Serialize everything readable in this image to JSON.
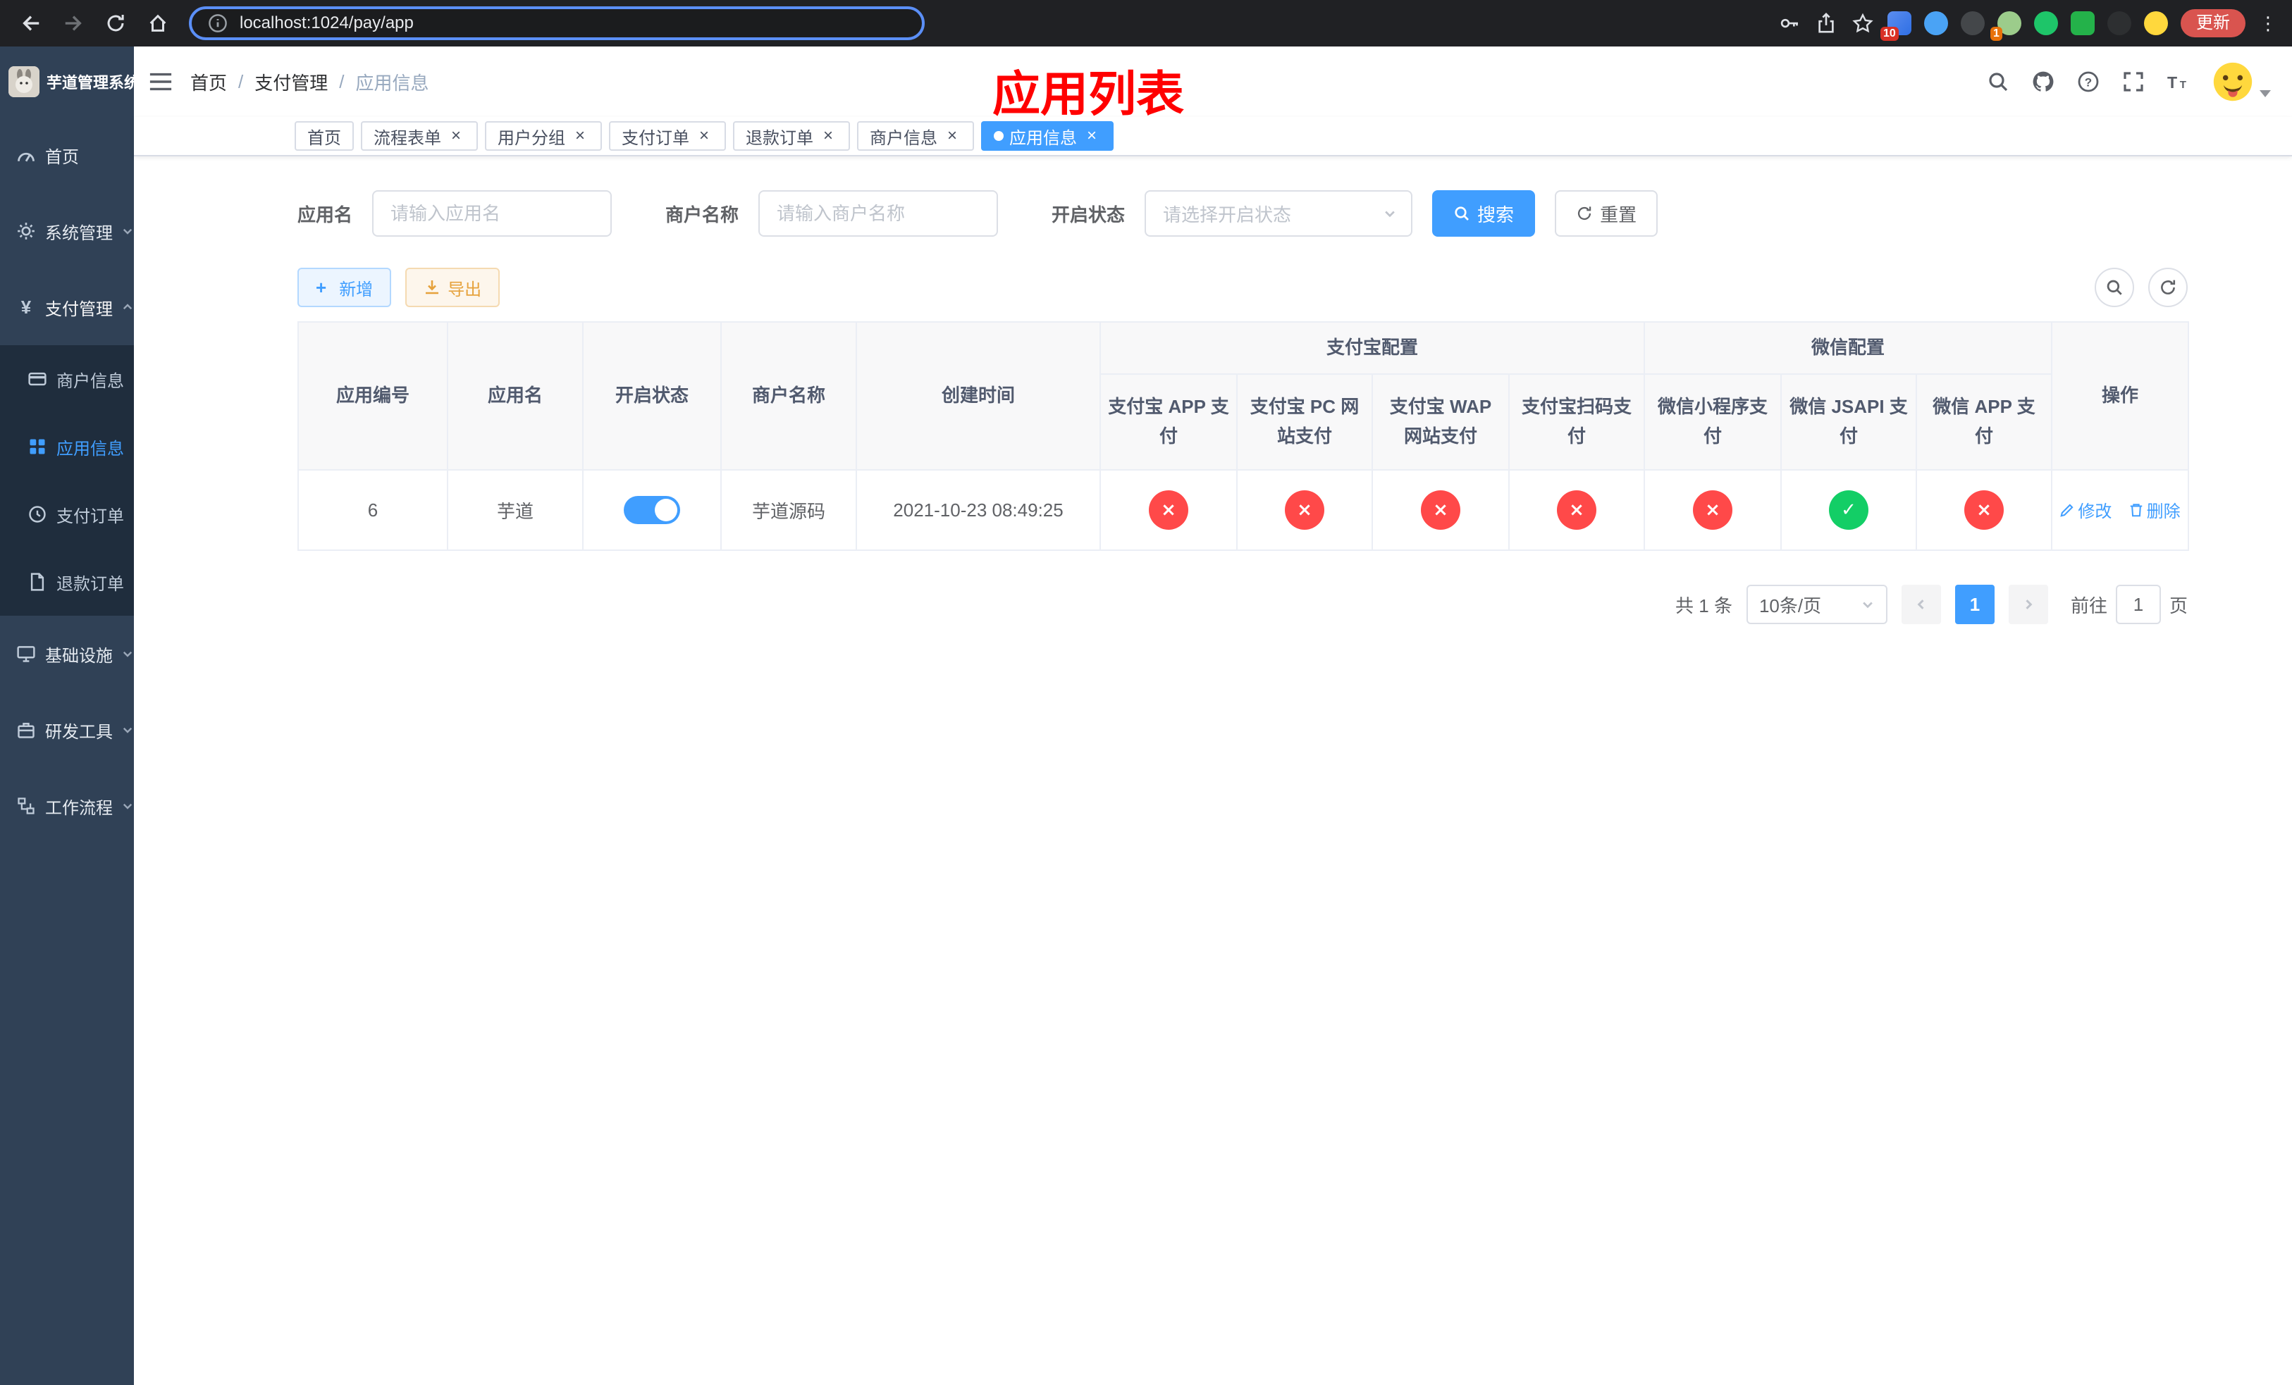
{
  "colors": {
    "accent": "#409eff",
    "sidebar_bg": "#304156",
    "submenu_bg": "#1f2d3d",
    "danger_circle": "#ff4949",
    "success_circle": "#13ce66",
    "warning": "#e6a23c",
    "annotation": "#ff0000",
    "active_tab_bg": "#409eff"
  },
  "browser": {
    "url": "localhost:1024/pay/app",
    "update_label": "更新",
    "ext_badge_a": "10",
    "ext_badge_b": "1"
  },
  "sidebar": {
    "title": "芋道管理系统",
    "items": [
      {
        "label": "首页"
      },
      {
        "label": "系统管理"
      },
      {
        "label": "支付管理"
      },
      {
        "label": "商户信息"
      },
      {
        "label": "应用信息"
      },
      {
        "label": "支付订单"
      },
      {
        "label": "退款订单"
      },
      {
        "label": "基础设施"
      },
      {
        "label": "研发工具"
      },
      {
        "label": "工作流程"
      }
    ]
  },
  "header": {
    "breadcrumb": {
      "home": "首页",
      "section": "支付管理",
      "current": "应用信息",
      "separator": "/"
    },
    "annotation": "应用列表"
  },
  "tabs": [
    {
      "label": "首页"
    },
    {
      "label": "流程表单"
    },
    {
      "label": "用户分组"
    },
    {
      "label": "支付订单"
    },
    {
      "label": "退款订单"
    },
    {
      "label": "商户信息"
    },
    {
      "label": "应用信息"
    }
  ],
  "filters": {
    "app_name": {
      "label": "应用名",
      "placeholder": "请输入应用名"
    },
    "merchant_name": {
      "label": "商户名称",
      "placeholder": "请输入商户名称"
    },
    "status": {
      "label": "开启状态",
      "placeholder": "请选择开启状态"
    },
    "search_label": "搜索",
    "reset_label": "重置"
  },
  "toolbar": {
    "add_label": "新增",
    "export_label": "导出"
  },
  "table": {
    "group_alipay": "支付宝配置",
    "group_wechat": "微信配置",
    "columns": {
      "id": "应用编号",
      "name": "应用名",
      "status": "开启状态",
      "merchant": "商户名称",
      "created": "创建时间",
      "alipay_app": "支付宝 APP 支付",
      "alipay_pc": "支付宝 PC 网站支付",
      "alipay_wap": "支付宝 WAP 网站支付",
      "alipay_qr": "支付宝扫码支付",
      "wx_lite": "微信小程序支付",
      "wx_jsapi": "微信 JSAPI 支付",
      "wx_app": "微信 APP 支付",
      "actions": "操作"
    },
    "rows": [
      {
        "id": "6",
        "name": "芋道",
        "enabled": true,
        "merchant": "芋道源码",
        "created": "2021-10-23 08:49:25",
        "channels": {
          "alipay_app": false,
          "alipay_pc": false,
          "alipay_wap": false,
          "alipay_qr": false,
          "wx_lite": false,
          "wx_jsapi": true,
          "wx_app": false
        },
        "edit_label": "修改",
        "delete_label": "删除"
      }
    ]
  },
  "pagination": {
    "total": "共 1 条",
    "page_size": "10条/页",
    "page": "1",
    "goto_prefix": "前往",
    "goto_value": "1",
    "goto_suffix": "页"
  }
}
